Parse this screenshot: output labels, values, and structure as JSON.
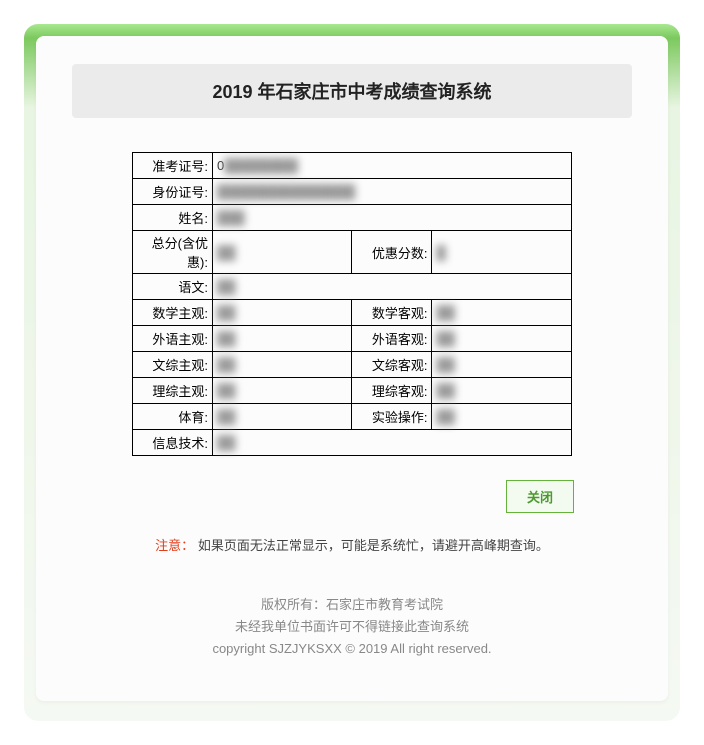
{
  "title": "2019 年石家庄市中考成绩查询系统",
  "labels": {
    "admission_no": "准考证号:",
    "id_no": "身份证号:",
    "name": "姓名:",
    "total": "总分(含优惠):",
    "discount": "优惠分数:",
    "chinese": "语文:",
    "math_subj": "数学主观:",
    "math_obj": "数学客观:",
    "foreign_subj": "外语主观:",
    "foreign_obj": "外语客观:",
    "wenzong_subj": "文综主观:",
    "wenzong_obj": "文综客观:",
    "lizong_subj": "理综主观:",
    "lizong_obj": "理综客观:",
    "pe": "体育:",
    "experiment": "实验操作:",
    "it": "信息技术:"
  },
  "values": {
    "admission_no": "0",
    "id_no": "",
    "name": "",
    "total": "",
    "discount": "",
    "chinese": "",
    "math_subj": "",
    "math_obj": "",
    "foreign_subj": "",
    "foreign_obj": "",
    "wenzong_subj": "",
    "wenzong_obj": "",
    "lizong_subj": "",
    "lizong_obj": "",
    "pe": "",
    "experiment": "",
    "it": ""
  },
  "close_label": "关闭",
  "notice_key": "注意：",
  "notice_text": "如果页面无法正常显示，可能是系统忙，请避开高峰期查询。",
  "footer_line1": "版权所有：石家庄市教育考试院",
  "footer_line2": "未经我单位书面许可不得链接此查询系统",
  "footer_line3": "copyright SJZJYKSXX © 2019 All right reserved."
}
